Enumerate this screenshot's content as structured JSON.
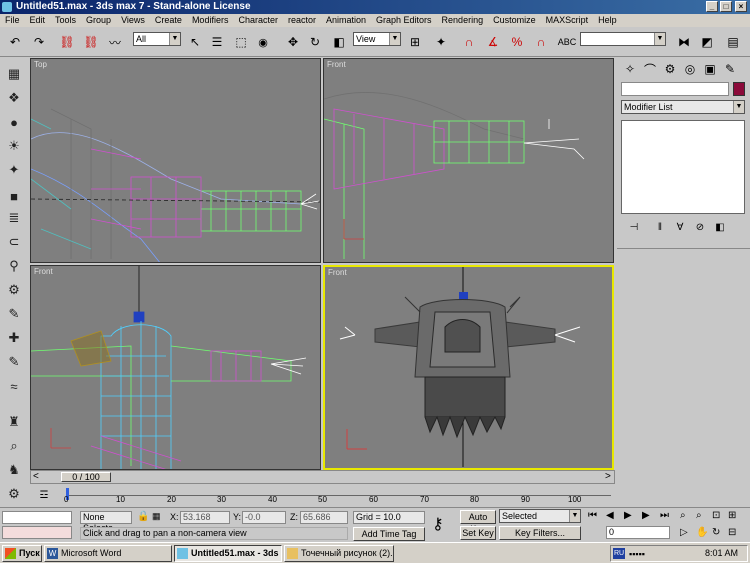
{
  "window": {
    "title": "Untitled51.max - 3ds max 7 - Stand-alone License"
  },
  "menu": [
    "File",
    "Edit",
    "Tools",
    "Group",
    "Views",
    "Create",
    "Modifiers",
    "Character",
    "reactor",
    "Animation",
    "Graph Editors",
    "Rendering",
    "Customize",
    "MAXScript",
    "Help"
  ],
  "toolbar": {
    "filter_select": "All",
    "coord_select": "View"
  },
  "viewports": {
    "top_left": "Top",
    "top_right": "Front",
    "bottom_left": "Front",
    "bottom_right": "Front"
  },
  "command_panel": {
    "modifier_list": "Modifier List",
    "accent_color": "#8b0a3a"
  },
  "timeline": {
    "frame_counter": "0 / 100",
    "ticks": [
      "10",
      "20",
      "30",
      "40",
      "50",
      "60",
      "70",
      "80",
      "90",
      "100"
    ],
    "tick_zero": "0"
  },
  "status": {
    "selection": "None Selecte",
    "x_label": "X:",
    "x_value": "53.168",
    "y_label": "Y:",
    "y_value": "-0.0",
    "z_label": "Z:",
    "z_value": "65.686",
    "grid": "Grid = 10.0",
    "prompt": "Click and drag to pan a non-camera view",
    "add_time_tag": "Add Time Tag",
    "auto_key": "Auto Key",
    "set_key": "Set Key",
    "key_mode": "Selected",
    "key_filters": "Key Filters...",
    "frame": "0"
  },
  "taskbar": {
    "start": "Пуск",
    "tasks": [
      "Microsoft Word",
      "Untitled51.max - 3ds ...",
      "Точечный рисунок (2)...."
    ],
    "lang": "RU",
    "time": "8:01 AM"
  }
}
